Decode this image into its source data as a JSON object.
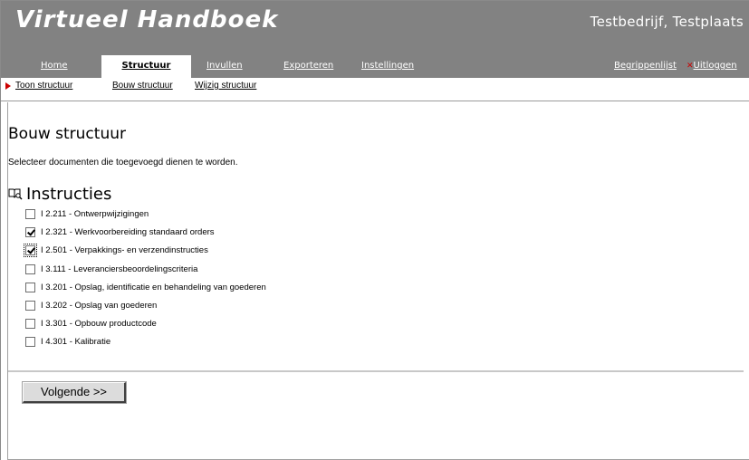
{
  "header": {
    "app_title": "Virtueel Handboek",
    "company": "Testbedrijf, Testplaats",
    "background_color": "#828282"
  },
  "nav": {
    "items": [
      {
        "label": "Home"
      },
      {
        "label": "Structuur",
        "active": true
      },
      {
        "label": "Invullen"
      },
      {
        "label": "Exporteren"
      },
      {
        "label": "Instellingen"
      }
    ],
    "right_items": [
      {
        "label": "Begrippenlijst"
      },
      {
        "label": "Uitloggen",
        "icon": "close-icon",
        "icon_color": "#cc0000"
      }
    ]
  },
  "subnav": {
    "items": [
      {
        "label": "Toon structuur",
        "current": true
      },
      {
        "label": "Bouw structuur"
      },
      {
        "label": "Wijzig structuur"
      }
    ],
    "arrow_color": "#cc0000"
  },
  "main": {
    "page_title": "Bouw structuur",
    "intro": "Selecteer documenten die toegevoegd dienen te worden.",
    "section": {
      "icon": "book-search-icon",
      "title": "Instructies",
      "items": [
        {
          "label": "I 2.211 - Ontwerpwijzigingen",
          "checked": false
        },
        {
          "label": "I 2.321 - Werkvoorbereiding standaard orders",
          "checked": true
        },
        {
          "label": "I 2.501 - Verpakkings- en verzendinstructies",
          "checked": true,
          "focused": true
        },
        {
          "label": "I 3.111 - Leveranciersbeoordelingscriteria",
          "checked": false
        },
        {
          "label": "I 3.201 - Opslag, identificatie en behandeling van goederen",
          "checked": false
        },
        {
          "label": "I 3.202 - Opslag van goederen",
          "checked": false
        },
        {
          "label": "I 3.301 - Opbouw productcode",
          "checked": false
        },
        {
          "label": "I 4.301 - Kalibratie",
          "checked": false
        }
      ]
    },
    "next_button": "Volgende >>"
  }
}
